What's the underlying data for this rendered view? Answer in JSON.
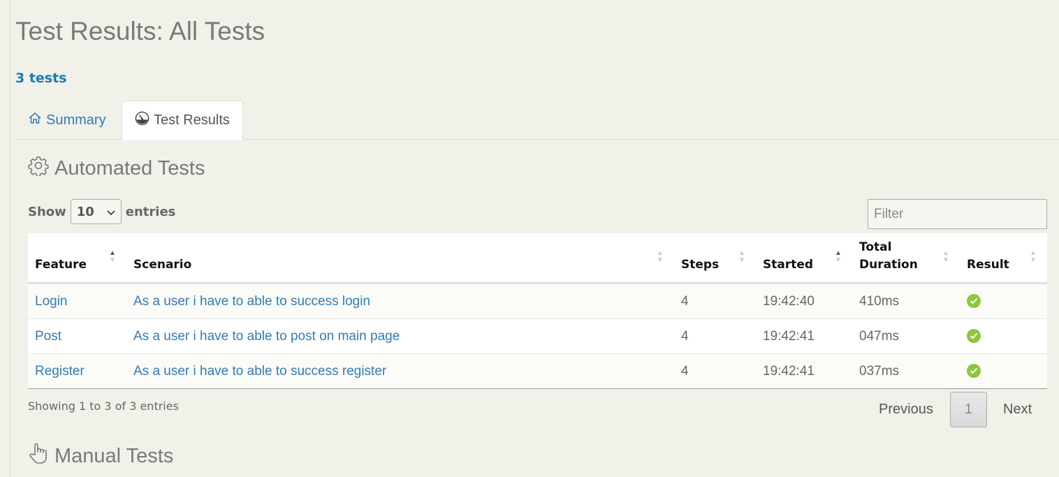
{
  "page": {
    "title": "Test Results: All Tests",
    "test_count": "3 tests"
  },
  "tabs": [
    {
      "label": "Summary",
      "icon": "home-icon",
      "active": false
    },
    {
      "label": "Test Results",
      "icon": "dashboard-gauge-icon",
      "active": true
    }
  ],
  "automated": {
    "title": "Automated Tests",
    "icon": "gear-icon",
    "length": {
      "prefix": "Show",
      "value": "10",
      "suffix": "entries"
    },
    "filter_placeholder": "Filter",
    "columns": [
      "Feature",
      "Scenario",
      "Steps",
      "Started",
      "Total Duration",
      "Result"
    ],
    "rows": [
      {
        "feature": "Login",
        "scenario": "As a user i have to able to success login",
        "steps": "4",
        "started": "19:42:40",
        "duration": "410ms",
        "result": "passed"
      },
      {
        "feature": "Post",
        "scenario": "As a user i have to able to post on main page",
        "steps": "4",
        "started": "19:42:41",
        "duration": "047ms",
        "result": "passed"
      },
      {
        "feature": "Register",
        "scenario": "As a user i have to able to success register",
        "steps": "4",
        "started": "19:42:41",
        "duration": "037ms",
        "result": "passed"
      }
    ],
    "info": "Showing 1 to 3 of 3 entries",
    "pagination": {
      "previous": "Previous",
      "current": "1",
      "next": "Next"
    }
  },
  "manual": {
    "title": "Manual Tests",
    "icon": "pointing-hand-icon"
  },
  "colors": {
    "link": "#337ab7",
    "count": "#1b7bb5",
    "success": "#8cc63f",
    "background": "#f1f1ea"
  }
}
